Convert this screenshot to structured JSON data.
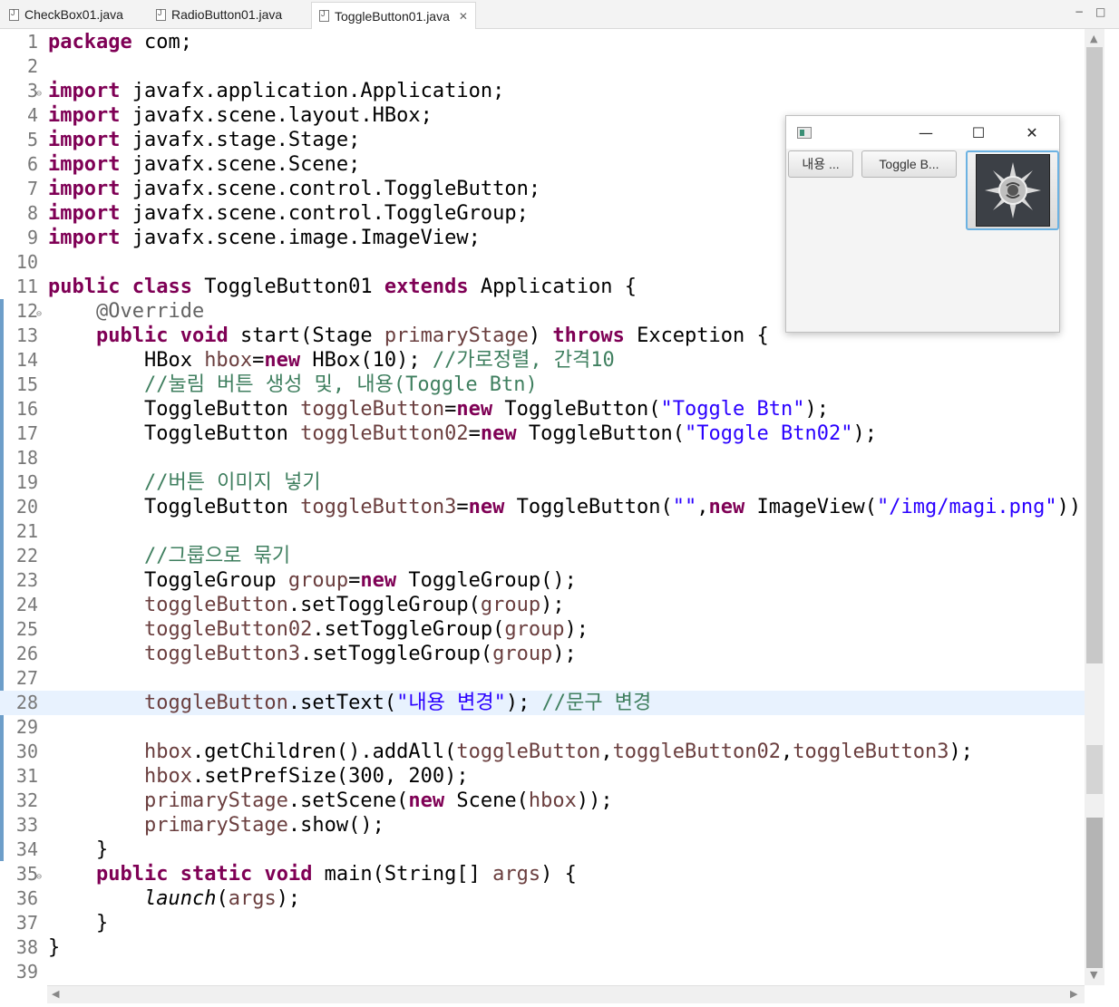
{
  "tabs": [
    {
      "label": "CheckBox01.java",
      "active": false
    },
    {
      "label": "RadioButton01.java",
      "active": false
    },
    {
      "label": "ToggleButton01.java",
      "active": true
    }
  ],
  "tab_close_glyph": "✕",
  "window_controls": {
    "minimize": "−",
    "maximize": "□"
  },
  "editor": {
    "highlighted_line": 28,
    "lines": [
      {
        "n": "1",
        "tokens": [
          {
            "t": "package",
            "c": "kw"
          },
          {
            "t": " com;"
          }
        ]
      },
      {
        "n": "2",
        "tokens": []
      },
      {
        "n": "3",
        "fold": true,
        "tokens": [
          {
            "t": "import",
            "c": "kw"
          },
          {
            "t": " javafx.application.Application;"
          }
        ]
      },
      {
        "n": "4",
        "tokens": [
          {
            "t": "import",
            "c": "kw"
          },
          {
            "t": " javafx.scene.layout.HBox;"
          }
        ]
      },
      {
        "n": "5",
        "tokens": [
          {
            "t": "import",
            "c": "kw"
          },
          {
            "t": " javafx.stage.Stage;"
          }
        ]
      },
      {
        "n": "6",
        "tokens": [
          {
            "t": "import",
            "c": "kw"
          },
          {
            "t": " javafx.scene.Scene;"
          }
        ]
      },
      {
        "n": "7",
        "tokens": [
          {
            "t": "import",
            "c": "kw"
          },
          {
            "t": " javafx.scene.control.ToggleButton;"
          }
        ]
      },
      {
        "n": "8",
        "tokens": [
          {
            "t": "import",
            "c": "kw"
          },
          {
            "t": " javafx.scene.control.ToggleGroup;"
          }
        ]
      },
      {
        "n": "9",
        "tokens": [
          {
            "t": "import",
            "c": "kw"
          },
          {
            "t": " javafx.scene.image.ImageView;"
          }
        ]
      },
      {
        "n": "10",
        "tokens": []
      },
      {
        "n": "11",
        "tokens": [
          {
            "t": "public",
            "c": "kw"
          },
          {
            "t": " "
          },
          {
            "t": "class",
            "c": "kw"
          },
          {
            "t": " ToggleButton01 "
          },
          {
            "t": "extends",
            "c": "kw"
          },
          {
            "t": " Application {"
          }
        ]
      },
      {
        "n": "12",
        "fold": true,
        "tokens": [
          {
            "t": "    "
          },
          {
            "t": "@Override",
            "c": "ann"
          }
        ]
      },
      {
        "n": "13",
        "tokens": [
          {
            "t": "    "
          },
          {
            "t": "public",
            "c": "kw"
          },
          {
            "t": " "
          },
          {
            "t": "void",
            "c": "kw"
          },
          {
            "t": " start(Stage "
          },
          {
            "t": "primaryStage",
            "c": "fld"
          },
          {
            "t": ") "
          },
          {
            "t": "throws",
            "c": "kw"
          },
          {
            "t": " Exception {"
          }
        ]
      },
      {
        "n": "14",
        "tokens": [
          {
            "t": "        HBox "
          },
          {
            "t": "hbox",
            "c": "fld"
          },
          {
            "t": "="
          },
          {
            "t": "new",
            "c": "kw"
          },
          {
            "t": " HBox(10); "
          },
          {
            "t": "//가로정렬, 간격10",
            "c": "cm"
          }
        ]
      },
      {
        "n": "15",
        "tokens": [
          {
            "t": "        "
          },
          {
            "t": "//눌림 버튼 생성 및, 내용(Toggle Btn)",
            "c": "cm"
          }
        ]
      },
      {
        "n": "16",
        "tokens": [
          {
            "t": "        ToggleButton "
          },
          {
            "t": "toggleButton",
            "c": "fld"
          },
          {
            "t": "="
          },
          {
            "t": "new",
            "c": "kw"
          },
          {
            "t": " ToggleButton("
          },
          {
            "t": "\"Toggle Btn\"",
            "c": "str"
          },
          {
            "t": ");"
          }
        ]
      },
      {
        "n": "17",
        "tokens": [
          {
            "t": "        ToggleButton "
          },
          {
            "t": "toggleButton02",
            "c": "fld"
          },
          {
            "t": "="
          },
          {
            "t": "new",
            "c": "kw"
          },
          {
            "t": " ToggleButton("
          },
          {
            "t": "\"Toggle Btn02\"",
            "c": "str"
          },
          {
            "t": ");"
          }
        ]
      },
      {
        "n": "18",
        "tokens": []
      },
      {
        "n": "19",
        "tokens": [
          {
            "t": "        "
          },
          {
            "t": "//버튼 이미지 넣기",
            "c": "cm"
          }
        ]
      },
      {
        "n": "20",
        "tokens": [
          {
            "t": "        ToggleButton "
          },
          {
            "t": "toggleButton3",
            "c": "fld"
          },
          {
            "t": "="
          },
          {
            "t": "new",
            "c": "kw"
          },
          {
            "t": " ToggleButton("
          },
          {
            "t": "\"\"",
            "c": "str"
          },
          {
            "t": ","
          },
          {
            "t": "new",
            "c": "kw"
          },
          {
            "t": " ImageView("
          },
          {
            "t": "\"/img/magi.png\"",
            "c": "str"
          },
          {
            "t": "));"
          }
        ]
      },
      {
        "n": "21",
        "tokens": []
      },
      {
        "n": "22",
        "tokens": [
          {
            "t": "        "
          },
          {
            "t": "//그룹으로 묶기",
            "c": "cm"
          }
        ]
      },
      {
        "n": "23",
        "tokens": [
          {
            "t": "        ToggleGroup "
          },
          {
            "t": "group",
            "c": "fld"
          },
          {
            "t": "="
          },
          {
            "t": "new",
            "c": "kw"
          },
          {
            "t": " ToggleGroup();"
          }
        ]
      },
      {
        "n": "24",
        "tokens": [
          {
            "t": "        "
          },
          {
            "t": "toggleButton",
            "c": "fld"
          },
          {
            "t": ".setToggleGroup("
          },
          {
            "t": "group",
            "c": "fld"
          },
          {
            "t": ");"
          }
        ]
      },
      {
        "n": "25",
        "tokens": [
          {
            "t": "        "
          },
          {
            "t": "toggleButton02",
            "c": "fld"
          },
          {
            "t": ".setToggleGroup("
          },
          {
            "t": "group",
            "c": "fld"
          },
          {
            "t": ");"
          }
        ]
      },
      {
        "n": "26",
        "tokens": [
          {
            "t": "        "
          },
          {
            "t": "toggleButton3",
            "c": "fld"
          },
          {
            "t": ".setToggleGroup("
          },
          {
            "t": "group",
            "c": "fld"
          },
          {
            "t": ");"
          }
        ]
      },
      {
        "n": "27",
        "tokens": []
      },
      {
        "n": "28",
        "tokens": [
          {
            "t": "        "
          },
          {
            "t": "toggleButton",
            "c": "fld"
          },
          {
            "t": ".setText("
          },
          {
            "t": "\"내용 변경\"",
            "c": "str"
          },
          {
            "t": "); "
          },
          {
            "t": "//문구 변경",
            "c": "cm"
          }
        ]
      },
      {
        "n": "29",
        "tokens": []
      },
      {
        "n": "30",
        "tokens": [
          {
            "t": "        "
          },
          {
            "t": "hbox",
            "c": "fld"
          },
          {
            "t": ".getChildren().addAll("
          },
          {
            "t": "toggleButton",
            "c": "fld"
          },
          {
            "t": ","
          },
          {
            "t": "toggleButton02",
            "c": "fld"
          },
          {
            "t": ","
          },
          {
            "t": "toggleButton3",
            "c": "fld"
          },
          {
            "t": ");"
          }
        ]
      },
      {
        "n": "31",
        "tokens": [
          {
            "t": "        "
          },
          {
            "t": "hbox",
            "c": "fld"
          },
          {
            "t": ".setPrefSize(300, 200);"
          }
        ]
      },
      {
        "n": "32",
        "tokens": [
          {
            "t": "        "
          },
          {
            "t": "primaryStage",
            "c": "fld"
          },
          {
            "t": ".setScene("
          },
          {
            "t": "new",
            "c": "kw"
          },
          {
            "t": " Scene("
          },
          {
            "t": "hbox",
            "c": "fld"
          },
          {
            "t": "));"
          }
        ]
      },
      {
        "n": "33",
        "tokens": [
          {
            "t": "        "
          },
          {
            "t": "primaryStage",
            "c": "fld"
          },
          {
            "t": ".show();"
          }
        ]
      },
      {
        "n": "34",
        "tokens": [
          {
            "t": "    }"
          }
        ]
      },
      {
        "n": "35",
        "fold": true,
        "tokens": [
          {
            "t": "    "
          },
          {
            "t": "public",
            "c": "kw"
          },
          {
            "t": " "
          },
          {
            "t": "static",
            "c": "kw"
          },
          {
            "t": " "
          },
          {
            "t": "void",
            "c": "kw"
          },
          {
            "t": " main(String[] "
          },
          {
            "t": "args",
            "c": "fld"
          },
          {
            "t": ") {"
          }
        ]
      },
      {
        "n": "36",
        "tokens": [
          {
            "t": "        "
          },
          {
            "t": "launch",
            "c": "stat"
          },
          {
            "t": "("
          },
          {
            "t": "args",
            "c": "fld"
          },
          {
            "t": ");"
          }
        ]
      },
      {
        "n": "37",
        "tokens": [
          {
            "t": "    }"
          }
        ]
      },
      {
        "n": "38",
        "tokens": [
          {
            "t": "}"
          }
        ]
      },
      {
        "n": "39",
        "tokens": []
      }
    ]
  },
  "fx_window": {
    "controls": {
      "minimize": "—",
      "maximize": "☐",
      "close": "✕"
    },
    "buttons": [
      {
        "label": "내용 ..."
      },
      {
        "label": "Toggle B..."
      }
    ],
    "image_button": {
      "icon": "magi-image-icon"
    }
  },
  "colors": {
    "keyword": "#7f0055",
    "string": "#2a00ff",
    "comment": "#3f7f5f",
    "field": "#6a3e3e",
    "current_line": "#e8f2fe",
    "selected_button_border": "#6cb2e2"
  }
}
